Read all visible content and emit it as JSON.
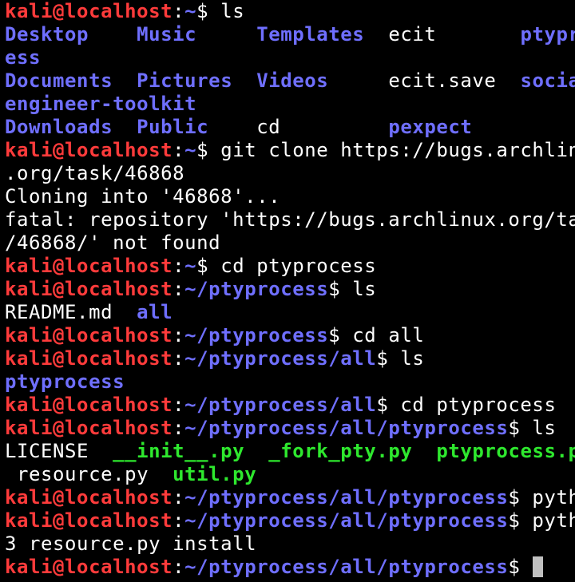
{
  "colors": {
    "background": "#000000",
    "prompt_user": "#ff3b3b",
    "prompt_path": "#6f6fff",
    "directory": "#6f6fff",
    "executable": "#2ee82e",
    "text": "#ffffff",
    "cursor": "#c0c0c0"
  },
  "terminal": {
    "lines": [
      [
        {
          "t": "kali@localhost",
          "k": "user",
          "name": "prompt-user"
        },
        {
          "t": ":",
          "k": "text",
          "name": "prompt-separator"
        },
        {
          "t": "~",
          "k": "path",
          "name": "prompt-path"
        },
        {
          "t": "$ ls",
          "k": "text",
          "name": "command-text"
        }
      ],
      [
        {
          "t": "Desktop",
          "k": "dir",
          "name": "directory-entry",
          "bold": true
        },
        {
          "t": "    ",
          "k": "text",
          "name": "spacer"
        },
        {
          "t": "Music",
          "k": "dir",
          "name": "directory-entry",
          "bold": true
        },
        {
          "t": "     ",
          "k": "text",
          "name": "spacer"
        },
        {
          "t": "Templates",
          "k": "dir",
          "name": "directory-entry",
          "bold": true
        },
        {
          "t": "  ecit       ",
          "k": "text",
          "name": "file-entry"
        },
        {
          "t": "ptyproc",
          "k": "dir",
          "name": "directory-entry",
          "bold": true
        }
      ],
      [
        {
          "t": "ess",
          "k": "dir",
          "name": "directory-entry",
          "bold": true
        }
      ],
      [
        {
          "t": "Documents",
          "k": "dir",
          "name": "directory-entry",
          "bold": true
        },
        {
          "t": "  ",
          "k": "text",
          "name": "spacer"
        },
        {
          "t": "Pictures",
          "k": "dir",
          "name": "directory-entry",
          "bold": true
        },
        {
          "t": "  ",
          "k": "text",
          "name": "spacer"
        },
        {
          "t": "Videos",
          "k": "dir",
          "name": "directory-entry",
          "bold": true
        },
        {
          "t": "     ecit.save  ",
          "k": "text",
          "name": "file-entry"
        },
        {
          "t": "social-",
          "k": "dir",
          "name": "directory-entry",
          "bold": true
        }
      ],
      [
        {
          "t": "engineer-toolkit",
          "k": "dir",
          "name": "directory-entry",
          "bold": true
        }
      ],
      [
        {
          "t": "Downloads",
          "k": "dir",
          "name": "directory-entry",
          "bold": true
        },
        {
          "t": "  ",
          "k": "text",
          "name": "spacer"
        },
        {
          "t": "Public",
          "k": "dir",
          "name": "directory-entry",
          "bold": true
        },
        {
          "t": "    cd         ",
          "k": "text",
          "name": "file-entry"
        },
        {
          "t": "pexpect",
          "k": "dir",
          "name": "directory-entry",
          "bold": true
        }
      ],
      [
        {
          "t": "kali@localhost",
          "k": "user",
          "name": "prompt-user"
        },
        {
          "t": ":",
          "k": "text",
          "name": "prompt-separator"
        },
        {
          "t": "~",
          "k": "path",
          "name": "prompt-path"
        },
        {
          "t": "$ git clone https://bugs.archlinux",
          "k": "text",
          "name": "command-text"
        }
      ],
      [
        {
          "t": ".org/task/46868",
          "k": "text",
          "name": "command-text"
        }
      ],
      [
        {
          "t": "Cloning into '46868'...",
          "k": "text",
          "name": "output-text"
        }
      ],
      [
        {
          "t": "fatal: repository 'https://bugs.archlinux.org/task",
          "k": "text",
          "name": "output-text"
        }
      ],
      [
        {
          "t": "/46868/' not found",
          "k": "text",
          "name": "output-text"
        }
      ],
      [
        {
          "t": "kali@localhost",
          "k": "user",
          "name": "prompt-user"
        },
        {
          "t": ":",
          "k": "text",
          "name": "prompt-separator"
        },
        {
          "t": "~",
          "k": "path",
          "name": "prompt-path"
        },
        {
          "t": "$ cd ptyprocess",
          "k": "text",
          "name": "command-text"
        }
      ],
      [
        {
          "t": "kali@localhost",
          "k": "user",
          "name": "prompt-user"
        },
        {
          "t": ":",
          "k": "text",
          "name": "prompt-separator"
        },
        {
          "t": "~/ptyprocess",
          "k": "path",
          "name": "prompt-path"
        },
        {
          "t": "$ ls",
          "k": "text",
          "name": "command-text"
        }
      ],
      [
        {
          "t": "README.md  ",
          "k": "text",
          "name": "file-entry"
        },
        {
          "t": "all",
          "k": "dir",
          "name": "directory-entry",
          "bold": true
        }
      ],
      [
        {
          "t": "kali@localhost",
          "k": "user",
          "name": "prompt-user"
        },
        {
          "t": ":",
          "k": "text",
          "name": "prompt-separator"
        },
        {
          "t": "~/ptyprocess",
          "k": "path",
          "name": "prompt-path"
        },
        {
          "t": "$ cd all",
          "k": "text",
          "name": "command-text"
        }
      ],
      [
        {
          "t": "kali@localhost",
          "k": "user",
          "name": "prompt-user"
        },
        {
          "t": ":",
          "k": "text",
          "name": "prompt-separator"
        },
        {
          "t": "~/ptyprocess/all",
          "k": "path",
          "name": "prompt-path"
        },
        {
          "t": "$ ls",
          "k": "text",
          "name": "command-text"
        }
      ],
      [
        {
          "t": "ptyprocess",
          "k": "dir",
          "name": "directory-entry",
          "bold": true
        }
      ],
      [
        {
          "t": "kali@localhost",
          "k": "user",
          "name": "prompt-user"
        },
        {
          "t": ":",
          "k": "text",
          "name": "prompt-separator"
        },
        {
          "t": "~/ptyprocess/all",
          "k": "path",
          "name": "prompt-path"
        },
        {
          "t": "$ cd ptyprocess",
          "k": "text",
          "name": "command-text"
        }
      ],
      [
        {
          "t": "kali@localhost",
          "k": "user",
          "name": "prompt-user"
        },
        {
          "t": ":",
          "k": "text",
          "name": "prompt-separator"
        },
        {
          "t": "~/ptyprocess/all/ptyprocess",
          "k": "path",
          "name": "prompt-path"
        },
        {
          "t": "$ ls",
          "k": "text",
          "name": "command-text"
        }
      ],
      [
        {
          "t": "LICENSE  ",
          "k": "text",
          "name": "file-entry"
        },
        {
          "t": "__init__.py",
          "k": "exe",
          "name": "executable-entry",
          "bold": true
        },
        {
          "t": "  ",
          "k": "text",
          "name": "spacer"
        },
        {
          "t": "_fork_pty.py",
          "k": "exe",
          "name": "executable-entry",
          "bold": true
        },
        {
          "t": "  ",
          "k": "text",
          "name": "spacer"
        },
        {
          "t": "ptyprocess.py",
          "k": "exe",
          "name": "executable-entry",
          "bold": true
        }
      ],
      [
        {
          "t": " resource.py  ",
          "k": "text",
          "name": "file-entry"
        },
        {
          "t": "util.py",
          "k": "exe",
          "name": "executable-entry",
          "bold": true
        }
      ],
      [
        {
          "t": "kali@localhost",
          "k": "user",
          "name": "prompt-user"
        },
        {
          "t": ":",
          "k": "text",
          "name": "prompt-separator"
        },
        {
          "t": "~/ptyprocess/all/ptyprocess",
          "k": "path",
          "name": "prompt-path"
        },
        {
          "t": "$ python",
          "k": "text",
          "name": "command-text"
        }
      ],
      [
        {
          "t": "kali@localhost",
          "k": "user",
          "name": "prompt-user"
        },
        {
          "t": ":",
          "k": "text",
          "name": "prompt-separator"
        },
        {
          "t": "~/ptyprocess/all/ptyprocess",
          "k": "path",
          "name": "prompt-path"
        },
        {
          "t": "$ python",
          "k": "text",
          "name": "command-text"
        }
      ],
      [
        {
          "t": "3 resource.py install",
          "k": "text",
          "name": "command-text"
        }
      ],
      [
        {
          "t": "kali@localhost",
          "k": "user",
          "name": "prompt-user"
        },
        {
          "t": ":",
          "k": "text",
          "name": "prompt-separator"
        },
        {
          "t": "~/ptyprocess/all/ptyprocess",
          "k": "path",
          "name": "prompt-path"
        },
        {
          "t": "$ ",
          "k": "text",
          "name": "command-text"
        }
      ]
    ],
    "cursor_line": 24
  }
}
